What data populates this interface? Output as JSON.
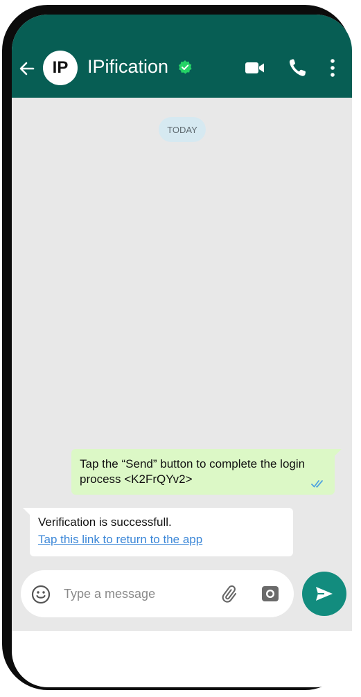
{
  "header": {
    "avatar_initials": "IP",
    "contact_name": "IPification",
    "icons": {
      "back": "arrow-left-icon",
      "verified": "verified-check-icon",
      "video": "video-camera-icon",
      "call": "phone-icon",
      "menu": "more-vertical-icon"
    }
  },
  "chat": {
    "date_label": "TODAY",
    "messages": [
      {
        "direction": "outgoing",
        "text": "Tap the “Send” button to complete the login process <K2FrQYv2>",
        "status_icon": "double-check-icon"
      },
      {
        "direction": "incoming",
        "text": "Verification is successfull.",
        "link_text": "Tap this link to return to the app"
      }
    ]
  },
  "composer": {
    "placeholder": "Type a message",
    "icons": {
      "emoji": "smiley-icon",
      "attach": "paperclip-icon",
      "camera": "camera-icon",
      "send": "send-icon"
    }
  },
  "colors": {
    "header": "#075e54",
    "chat_background": "#e8e8e8",
    "outgoing_bubble": "#dcf8c6",
    "incoming_bubble": "#ffffff",
    "link": "#3a86d7",
    "send_button": "#128c7e",
    "verified_badge": "#25d366"
  }
}
